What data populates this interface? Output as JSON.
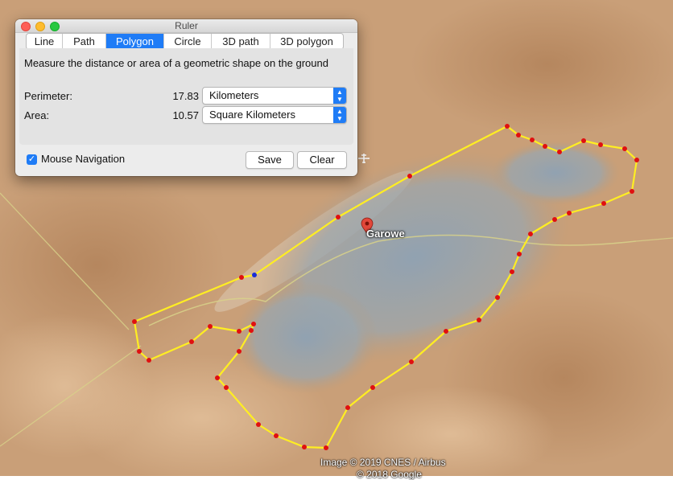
{
  "window": {
    "title": "Ruler",
    "tabs": [
      {
        "label": "Line",
        "active": false
      },
      {
        "label": "Path",
        "active": false
      },
      {
        "label": "Polygon",
        "active": true
      },
      {
        "label": "Circle",
        "active": false
      },
      {
        "label": "3D path",
        "active": false
      },
      {
        "label": "3D polygon",
        "active": false
      }
    ],
    "description": "Measure the distance or area of a geometric shape on the ground",
    "perimeter": {
      "label": "Perimeter:",
      "value": "17.83",
      "unit": "Kilometers"
    },
    "area": {
      "label": "Area:",
      "value": "10.57",
      "unit": "Square Kilometers"
    },
    "mouse_navigation": {
      "label": "Mouse Navigation",
      "checked": true
    },
    "save_label": "Save",
    "clear_label": "Clear"
  },
  "map": {
    "place_label": "Garowe",
    "credits": [
      "Image © 2019 CNES / Airbus",
      "© 2018 Google"
    ],
    "colors": {
      "polygon": "#ffee22",
      "vertex": "#e01010",
      "active_vertex": "#1a2ed8",
      "pin": "#e2473a"
    }
  }
}
